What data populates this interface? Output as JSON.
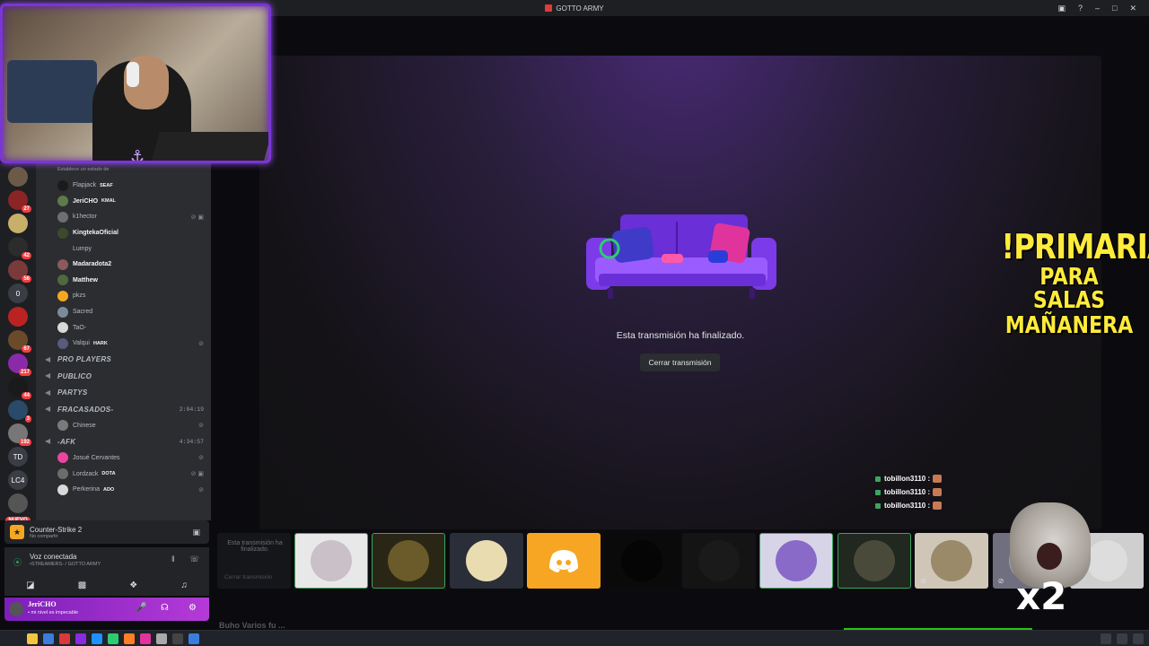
{
  "window": {
    "title": "GOTTO ARMY"
  },
  "sidebar": {
    "status_note": "Establece un estado de",
    "members": [
      {
        "name": "Flapjack",
        "tag": "SEAF",
        "color": "#1b1b1b",
        "bold": false
      },
      {
        "name": "JeriCHO",
        "tag": "KMAL",
        "color": "#5e7a4a",
        "bold": true
      },
      {
        "name": "k1hector",
        "tag": "",
        "color": "#6f6f6f",
        "bold": false,
        "status": "⊘ ▣"
      },
      {
        "name": "KingtekaOficial",
        "tag": "",
        "color": "#3c4a2c",
        "bold": true
      },
      {
        "name": "Lumpy",
        "tag": "",
        "color": "#2b2d31",
        "bold": false
      },
      {
        "name": "Madaradota2",
        "tag": "",
        "color": "#8c5a5a",
        "bold": true
      },
      {
        "name": "Matthew",
        "tag": "",
        "color": "#4e6a3e",
        "bold": true
      },
      {
        "name": "pkzs",
        "tag": "",
        "color": "#f5a623",
        "bold": false
      },
      {
        "name": "Sacred",
        "tag": "",
        "color": "#7a8c99",
        "bold": false
      },
      {
        "name": "TaO-",
        "tag": "",
        "color": "#d8d8d8",
        "bold": false
      },
      {
        "name": "Valqui",
        "tag": "HARK",
        "color": "#5a5a7a",
        "bold": false,
        "status": "⊘"
      }
    ],
    "voice_channels": [
      {
        "name": "PRO PLAYERS",
        "time": ""
      },
      {
        "name": "PUBLICO",
        "time": ""
      },
      {
        "name": "PARTYS",
        "time": ""
      },
      {
        "name": "FRACASADOS-",
        "time": "2:04:19"
      }
    ],
    "fracasados_members": [
      {
        "name": "Chinese",
        "color": "#7a7a7a",
        "status": "⊘"
      }
    ],
    "afk_channel": {
      "name": "-AFK",
      "time": "4:34:57"
    },
    "afk_members": [
      {
        "name": "Josué Cervantes",
        "tag": "",
        "color": "#eb459e",
        "status": "⊘"
      },
      {
        "name": "Lordzack",
        "tag": "DOTA",
        "color": "#6c6c6c",
        "status": "⊘ ▣"
      },
      {
        "name": "Perkerina",
        "tag": "ADO",
        "color": "#d8d8d8",
        "status": "⊘"
      }
    ]
  },
  "rail": {
    "servers": [
      {
        "label": "",
        "badge": "",
        "color": "#6b5a47"
      },
      {
        "label": "",
        "badge": "27",
        "color": "#8b2424"
      },
      {
        "label": "",
        "badge": "",
        "color": "#c8b06a"
      },
      {
        "label": "",
        "badge": "42",
        "color": "#2c2c2c"
      },
      {
        "label": "",
        "badge": "56",
        "color": "#7a3a3a"
      },
      {
        "label": "0",
        "badge": "",
        "color": "#3a3d44"
      },
      {
        "label": "",
        "badge": "",
        "color": "#b22"
      },
      {
        "label": "",
        "badge": "67",
        "color": "#6b4a2a"
      },
      {
        "label": "",
        "badge": "217",
        "color": "#8a2aa8"
      },
      {
        "label": "",
        "badge": "44",
        "color": "#1a1a1a"
      },
      {
        "label": "",
        "badge": "3",
        "color": "#2a4a6a"
      },
      {
        "label": "",
        "badge": "192",
        "color": "#777"
      },
      {
        "label": "TD",
        "badge": "",
        "color": "#3a3d44"
      },
      {
        "label": "LC4",
        "badge": "",
        "color": "#3a3d44"
      },
      {
        "label": "",
        "badge": "",
        "color": "#555"
      }
    ],
    "new_label": "NUEVO"
  },
  "activity": {
    "game": "Counter-Strike 2",
    "status": "No compartir"
  },
  "voice": {
    "title": "Voz conectada",
    "channel": "•STREAMERS- / GOTTO ARMY"
  },
  "user": {
    "name": "JeriCHO",
    "status": "• mi nivel es impecable"
  },
  "stage": {
    "ended_text": "Esta transmisión ha finalizado.",
    "close_label": "Cerrar transmisión"
  },
  "overlay": {
    "line1": "!PRIMARIA",
    "line2": "PARA SALAS",
    "line3": "MAÑANERA",
    "x2": "x2"
  },
  "chat": [
    {
      "user": "tobillon3110",
      "sep": ":"
    },
    {
      "user": "tobillon3110",
      "sep": ":"
    },
    {
      "user": "tobillon3110",
      "sep": ":"
    }
  ],
  "tiles": {
    "first_title": "Esta transmisión ha finalizado.",
    "first_button": "Cerrar transmisión",
    "items": [
      {
        "color": "#c9c0c8",
        "bg": "#e8e8e8",
        "selected": true
      },
      {
        "color": "#6b5a2a",
        "bg": "#2a2616",
        "selected": true
      },
      {
        "color": "#e8dcb0",
        "bg": "#2a2e38",
        "selected": false
      },
      {
        "color": "#ffffff",
        "bg": "#f6a623",
        "selected": false,
        "discord": true
      },
      {
        "color": "#050505",
        "bg": "#0a0a0a",
        "selected": false
      },
      {
        "color": "#1a1a1a",
        "bg": "#141414",
        "selected": false
      },
      {
        "color": "#8a6ac8",
        "bg": "#d8d4e8",
        "selected": true
      },
      {
        "color": "#4a4a3a",
        "bg": "#202820",
        "selected": true
      },
      {
        "color": "#9a8a6a",
        "bg": "#cfc6b8",
        "selected": false,
        "mute": true
      },
      {
        "color": "#9a9aa8",
        "bg": "#6f6f80",
        "selected": false,
        "mute": true
      },
      {
        "color": "#ddd",
        "bg": "#cfcfcf",
        "selected": false
      }
    ]
  },
  "below_text": "Buho Varios fu ..."
}
